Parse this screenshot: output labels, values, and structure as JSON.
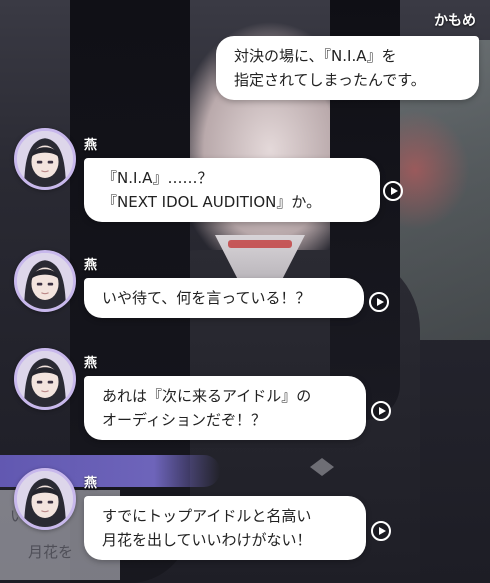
{
  "conversation": {
    "self_message": {
      "speaker": "かもめ",
      "text": "対決の場に、『N.I.A』を\n指定されてしまったんです。"
    },
    "messages": [
      {
        "speaker": "燕",
        "text": "『N.I.A』……？\n『NEXT IDOL AUDITION』か。",
        "voice_icon": "play-voice-icon"
      },
      {
        "speaker": "燕",
        "text": "いや待て、何を言っている！？",
        "voice_icon": "play-voice-icon"
      },
      {
        "speaker": "燕",
        "text": "あれは『次に来るアイドル』の\nオーディションだぞ！？",
        "voice_icon": "play-voice-icon"
      },
      {
        "speaker": "燕",
        "text": "すでにトップアイドルと名高い\n月花を出していいわけがない！",
        "voice_icon": "play-voice-icon"
      }
    ]
  },
  "background_peek": {
    "line1": "い",
    "line2": "月花を"
  },
  "colors": {
    "bubble": "#ffffff",
    "text": "#222222",
    "avatar_ring": "#c8b8ec",
    "strip": "#7d72d6"
  }
}
